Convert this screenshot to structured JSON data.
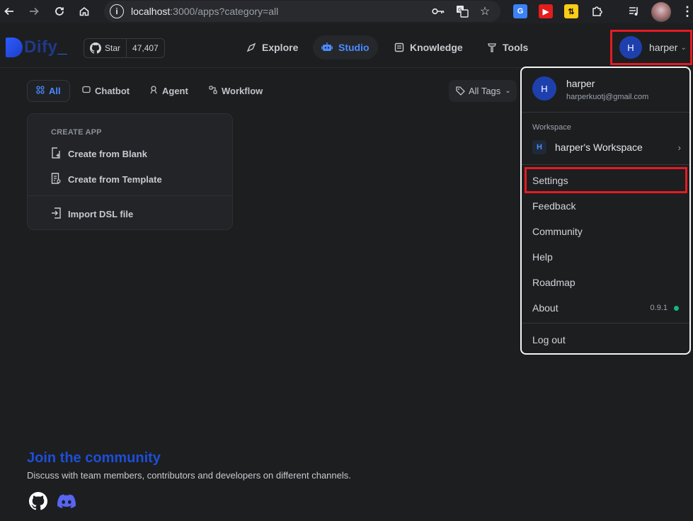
{
  "browser": {
    "url_host": "localhost",
    "url_path": ":3000/apps?category=all"
  },
  "header": {
    "logo_text": "Dify",
    "logo_underscore": "_",
    "github_star_label": "Star",
    "github_star_count": "47,407",
    "nav": [
      {
        "label": "Explore",
        "icon": "compass-icon"
      },
      {
        "label": "Studio",
        "icon": "robot-icon",
        "active": true
      },
      {
        "label": "Knowledge",
        "icon": "book-icon"
      },
      {
        "label": "Tools",
        "icon": "hammer-icon"
      }
    ],
    "user_initial": "H",
    "user_name": "harper"
  },
  "categories": {
    "tabs": [
      "All",
      "Chatbot",
      "Agent",
      "Workflow"
    ],
    "active": "All",
    "tags_label": "All Tags"
  },
  "create_card": {
    "heading": "CREATE APP",
    "blank": "Create from Blank",
    "template": "Create from Template",
    "import": "Import DSL file"
  },
  "footer": {
    "title": "Join the community",
    "description": "Discuss with team members, contributors and developers on different channels."
  },
  "dropdown": {
    "avatar_initial": "H",
    "name": "harper",
    "email": "harperkuotj@gmail.com",
    "workspace_label": "Workspace",
    "workspace_badge": "H",
    "workspace_name": "harper's Workspace",
    "items": {
      "settings": "Settings",
      "feedback": "Feedback",
      "community": "Community",
      "help": "Help",
      "roadmap": "Roadmap",
      "about": "About",
      "logout": "Log out"
    },
    "version": "0.9.1"
  },
  "colors": {
    "accent": "#4b8bff",
    "highlight": "#e31b23",
    "status_ok": "#10b981"
  }
}
